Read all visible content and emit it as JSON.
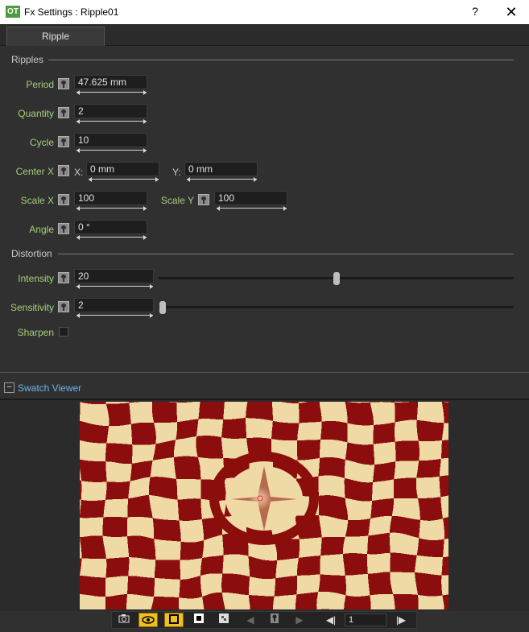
{
  "window": {
    "title": "Fx Settings : Ripple01",
    "logo": "OT",
    "help_label": "?",
    "close_label": "✕"
  },
  "tab": {
    "label": "Ripple"
  },
  "ripples": {
    "label": "Ripples",
    "period": {
      "label": "Period",
      "value": "47.625 mm"
    },
    "quantity": {
      "label": "Quantity",
      "value": "2"
    },
    "cycle": {
      "label": "Cycle",
      "value": "10"
    },
    "center": {
      "label": "Center X",
      "x_label": "X:",
      "x_value": "0 mm",
      "y_label": "Y:",
      "y_value": "0 mm"
    },
    "scale_x": {
      "label": "Scale X",
      "value": "100"
    },
    "scale_y": {
      "label": "Scale Y",
      "value": "100"
    },
    "angle": {
      "label": "Angle",
      "value": "0 °"
    }
  },
  "distortion": {
    "label": "Distortion",
    "intensity": {
      "label": "Intensity",
      "value": "20",
      "slider_fraction": 0.5
    },
    "sensitivity": {
      "label": "Sensitivity",
      "value": "2",
      "slider_fraction": 0.0
    },
    "sharpen": {
      "label": "Sharpen",
      "checked": false
    }
  },
  "swatch": {
    "toggle_label": "−",
    "title": "Swatch Viewer",
    "colors": {
      "dark": "#8b0e0a",
      "light": "#efd9a5"
    }
  },
  "toolbar": {
    "icons": [
      "camera-icon",
      "eye-icon",
      "square-outline-icon",
      "white-square-icon",
      "checker-square-icon",
      "prev-arrow-icon",
      "pin-icon",
      "next-arrow-icon",
      "first-frame-icon",
      "last-frame-icon"
    ],
    "frame_value": "1"
  }
}
